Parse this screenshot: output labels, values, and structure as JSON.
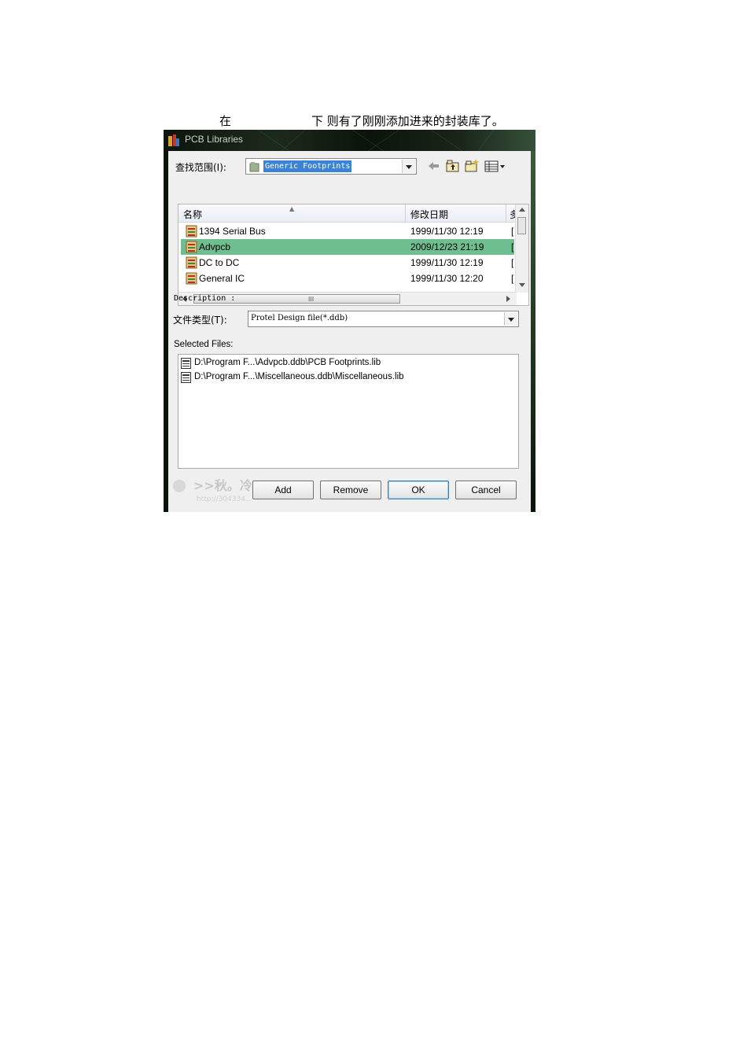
{
  "caption": {
    "part1": "在",
    "part2": "下  则有了刚刚添加进来的封装库了。"
  },
  "dialog": {
    "title": "PCB Libraries",
    "look_in_label": "查找范围(I):",
    "look_in_value": "Generic Footprints",
    "file_list": {
      "columns": [
        "名称",
        "修改日期",
        "多"
      ],
      "rows": [
        {
          "name": "1394 Serial Bus",
          "date": "1999/11/30 12:19",
          "type": "[",
          "selected": false
        },
        {
          "name": "Advpcb",
          "date": "2009/12/23 21:19",
          "type": "[",
          "selected": true
        },
        {
          "name": "DC to DC",
          "date": "1999/11/30 12:19",
          "type": "[",
          "selected": false
        },
        {
          "name": "General IC",
          "date": "1999/11/30 12:20",
          "type": "[",
          "selected": false
        }
      ],
      "scroll_grip": "III"
    },
    "description_label": "Description :",
    "file_type_label": "文件类型(T):",
    "file_type_value": "Protel Design file(*.ddb)",
    "selected_files_label": "Selected Files:",
    "selected_files": [
      "D:\\Program F...\\Advpcb.ddb\\PCB Footprints.lib",
      "D:\\Program F...\\Miscellaneous.ddb\\Miscellaneous.lib"
    ],
    "buttons": {
      "add": "Add",
      "remove": "Remove",
      "ok": "OK",
      "cancel": "Cancel"
    },
    "watermark": ">>秋。冷",
    "watermark_url": "http://304334..."
  },
  "colors": {
    "selection": "#6fbe8f",
    "highlight": "#3a83d6",
    "title_frame": "#0b120b"
  },
  "icons": [
    "folder-icon",
    "back-icon",
    "up-folder-icon",
    "new-folder-icon",
    "view-menu-icon",
    "database-icon",
    "lib-file-icon"
  ]
}
